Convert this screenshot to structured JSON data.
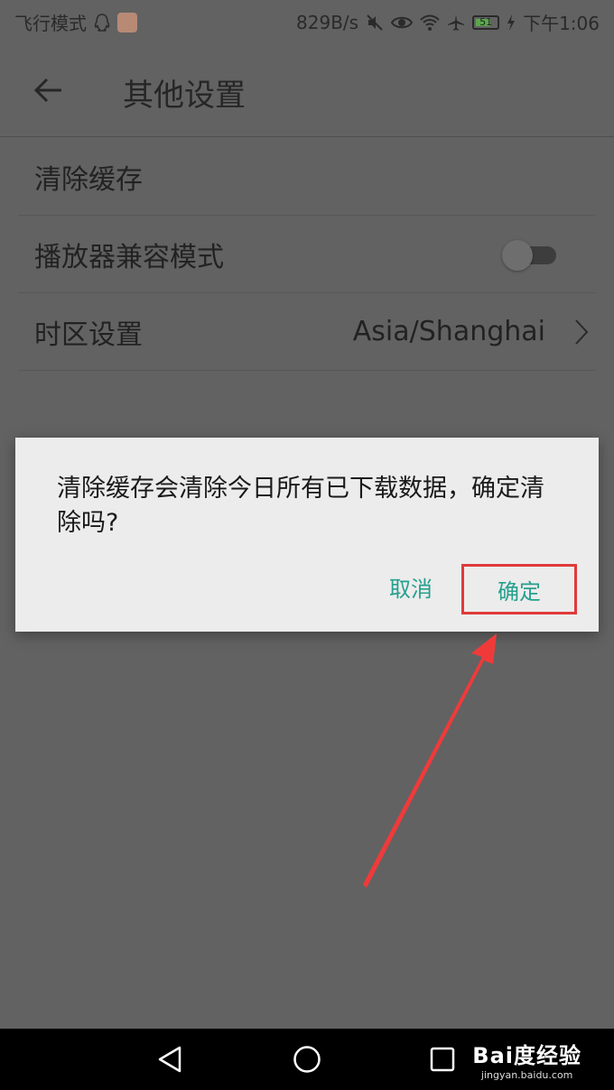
{
  "status_bar": {
    "mode": "飞行模式",
    "speed": "829B/s",
    "battery": "51",
    "time": "下午1:06"
  },
  "header": {
    "title": "其他设置"
  },
  "settings": {
    "clear_cache": "清除缓存",
    "player_compat": "播放器兼容模式",
    "player_compat_enabled": false,
    "timezone_label": "时区设置",
    "timezone_value": "Asia/Shanghai"
  },
  "dialog": {
    "message": "清除缓存会清除今日所有已下载数据，确定清除吗?",
    "cancel": "取消",
    "confirm": "确定"
  },
  "icons": {
    "back": "arrow-left-icon",
    "chevron": "chevron-right-icon",
    "nav_back": "triangle-back-icon",
    "nav_home": "circle-home-icon",
    "nav_recent": "square-recent-icon"
  },
  "watermark": {
    "main": "Bai度经验",
    "sub": "jingyan.baidu.com"
  },
  "colors": {
    "accent": "#26a08e",
    "highlight": "#e03a3a"
  }
}
